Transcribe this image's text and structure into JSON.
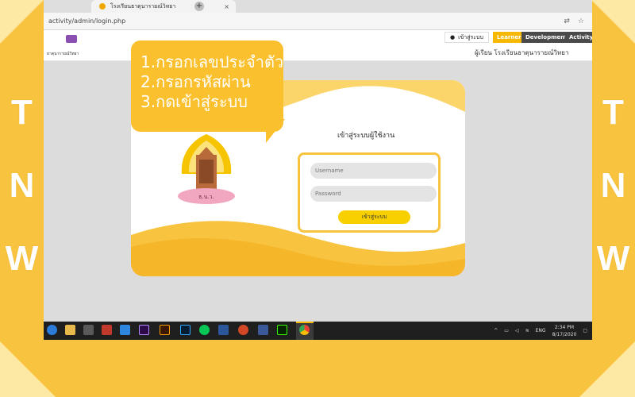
{
  "side_letters": {
    "left": [
      "T",
      "N",
      "W"
    ],
    "right": [
      "T",
      "N",
      "W"
    ]
  },
  "browser": {
    "tab_title": "โรงเรียนธาตุนารายณ์วิทยา",
    "tab_close": "×",
    "new_tab": "+",
    "url": "activity/admin/login.php"
  },
  "site": {
    "logo_text": "ธาตุนารายณ์วิทยา",
    "login_link": "เข้าสู่ระบบ",
    "nav": [
      "Learner",
      "Development",
      "Activity"
    ],
    "school_name": "ผู้เรียน โรงเรียนธาตุนารายณ์วิทยา"
  },
  "bubble": {
    "lines": [
      "1.กรอกเลขประจำตัว",
      "2.กรอกรหัสผ่าน",
      "3.กดเข้าสู่ระบบ"
    ]
  },
  "login_form": {
    "title": "เข้าสู่ระบบผู้ใช้งาน",
    "username_placeholder": "Username",
    "password_placeholder": "Password",
    "submit_label": "เข้าสู่ระบบ"
  },
  "emblem": {
    "caption": "ธ.น.ว."
  },
  "taskbar": {
    "lang": "ENG",
    "time": "2:34 PM",
    "date": "8/17/2020"
  },
  "colors": {
    "accent": "#f8c33f",
    "bubble": "#fbc02d",
    "button": "#f8d000"
  }
}
